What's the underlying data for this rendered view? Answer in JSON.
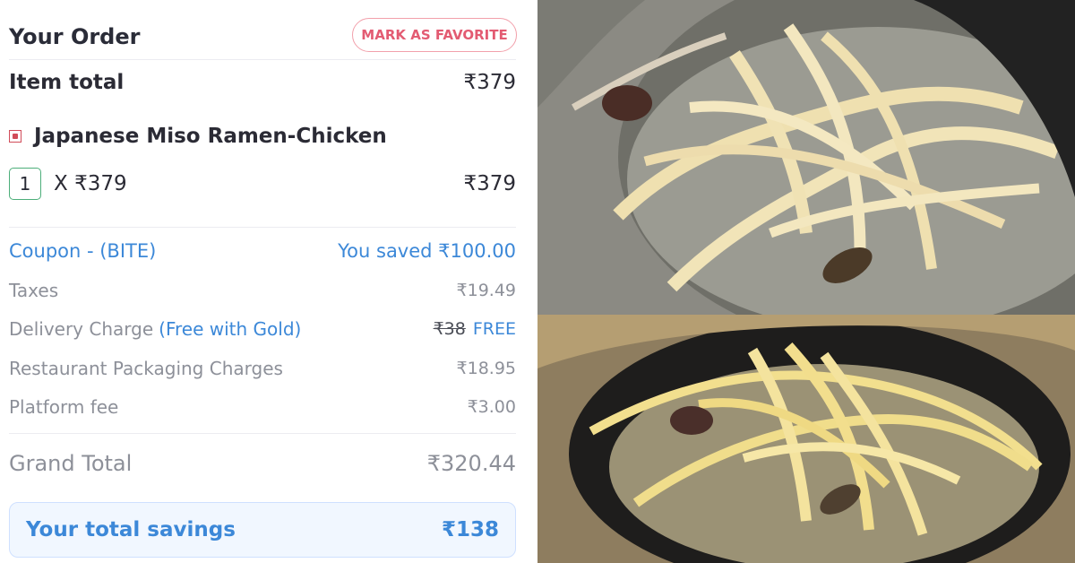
{
  "order": {
    "title": "Your Order",
    "favorite_label": "MARK AS FAVORITE",
    "item_total_label": "Item total",
    "item_total_value": "₹379",
    "item_name": "Japanese Miso Ramen-Chicken",
    "quantity": "1",
    "price_line": "X ₹379",
    "line_total": "₹379",
    "coupon_label": "Coupon - (BITE)",
    "coupon_value": "You saved ₹100.00",
    "taxes_label": "Taxes",
    "taxes_value": "₹19.49",
    "delivery_label": "Delivery Charge",
    "delivery_note": "(Free with Gold)",
    "delivery_original": "₹38",
    "delivery_value": "FREE",
    "packaging_label": "Restaurant Packaging Charges",
    "packaging_value": "₹18.95",
    "platform_label": "Platform fee",
    "platform_value": "₹3.00",
    "grand_total_label": "Grand Total",
    "grand_total_value": "₹320.44",
    "savings_label": "Your total savings",
    "savings_value": "₹138"
  },
  "colors": {
    "accent_blue": "#3c88d8",
    "accent_pink": "#e35b72",
    "qty_green": "#4cae7a",
    "veg_red": "#d14d5a"
  },
  "icons": {
    "food_type": "non-veg-square-icon"
  }
}
